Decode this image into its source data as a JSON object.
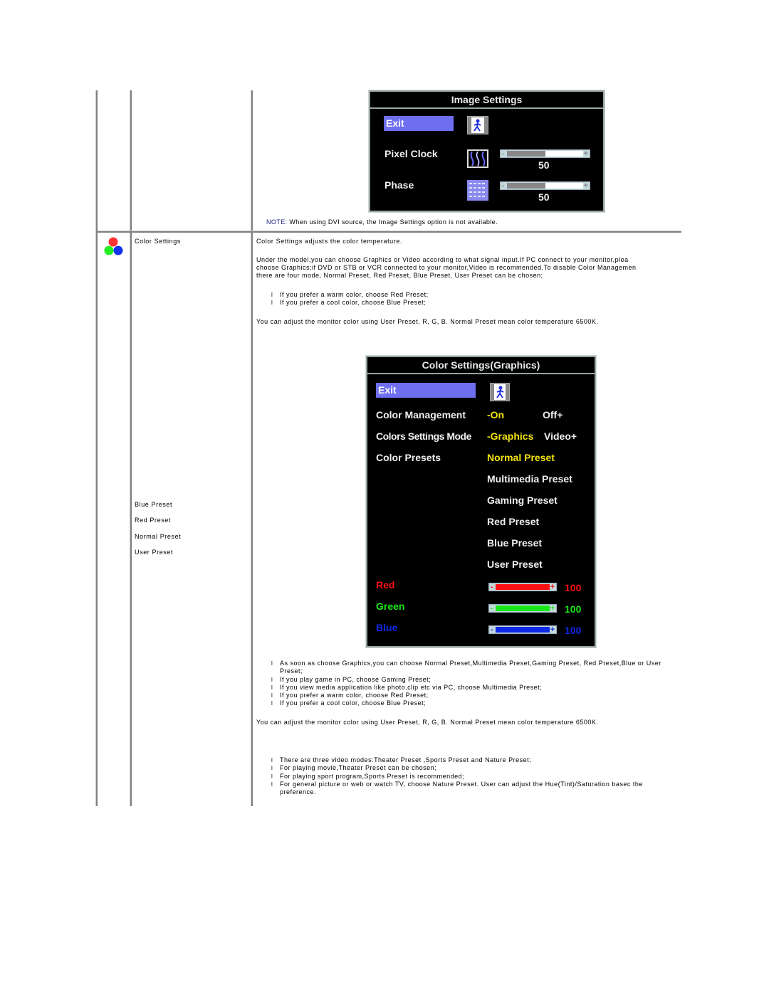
{
  "image_settings_osd": {
    "title": "Image Settings",
    "exit_label": "Exit",
    "rows": [
      {
        "label": "Pixel Clock",
        "icon": "pixel-clock-icon",
        "value": "50",
        "percent": 50
      },
      {
        "label": "Phase",
        "icon": "phase-icon",
        "value": "50",
        "percent": 50
      }
    ],
    "note_label": "NOTE:",
    "note_text": " When using  DVI source, the Image Settings option is not available."
  },
  "color_settings_row": {
    "icon": "color-circles-icon",
    "menu_name": "Color Settings",
    "sub_items": [
      "Blue Preset",
      "Red Preset",
      "Normal Preset",
      "User Preset"
    ],
    "intro": "Color Settings adjusts the color temperature.",
    "paragraph_lines": [
      "Under the model,you can choose Graphics or Video according to what signal input.If PC connect to your monitor,plea",
      "choose Graphics;if DVD or STB or VCR connected to your monitor,Video is recommended.To disable Color Managemen",
      "there are four mode, Normal Preset, Red Preset, Blue Preset, User Preset can be chosen;"
    ],
    "bullets_1": [
      "If you prefer a warm color, choose Red Preset;",
      "If you prefer a cool color, choose Blue Preset;"
    ],
    "adjust_note_1": "You can adjust the monitor color using User Preset, R, G, B. Normal Preset mean color temperature 6500K.",
    "bullets_2": [
      "As soon as choose Graphics,you can choose Normal Preset,Multimedia Preset,Gaming Preset, Red Preset,Blue or User Preset;",
      "If you play game in PC, choose Gaming Preset;",
      "If you view media application like photo,clip etc via PC, choose Multimedia Preset;",
      "If you prefer a warm color, choose Red Preset;",
      "If you prefer a cool color, choose Blue Preset;"
    ],
    "adjust_note_2": "You can adjust the monitor color using User Preset, R, G, B. Normal Preset mean color temperature 6500K.",
    "bullets_3": [
      "There are three video modes:Theater Preset ,Sports Preset and Nature Preset;",
      "For playing movie,Theater Preset can be chosen;",
      "For playing sport program,Sports Preset is recommended;",
      "For general picture or web or watch TV, choose Nature Preset. User can adjust the Hue(Tint)/Saturation basec the preference."
    ],
    "bullet_glyph": "l"
  },
  "color_settings_osd": {
    "title": "Color Settings(Graphics)",
    "exit_label": "Exit",
    "color_management": {
      "label": "Color Management",
      "selected": "-On",
      "other": "Off+"
    },
    "mode": {
      "label": "Colors Settings Mode",
      "selected": "-Graphics",
      "other": "Video+"
    },
    "presets": {
      "label": "Color Presets",
      "selected": "Normal Preset",
      "options": [
        "Multimedia Preset",
        "Gaming Preset",
        "Red Preset",
        "Blue Preset",
        "User Preset"
      ]
    },
    "channels": [
      {
        "label": "Red",
        "value": "100",
        "percent": 100,
        "color": "#ff1010"
      },
      {
        "label": "Green",
        "value": "100",
        "percent": 100,
        "color": "#18e818"
      },
      {
        "label": "Blue",
        "value": "100",
        "percent": 100,
        "color": "#1028e8"
      }
    ],
    "colors": {
      "highlight": "#f2e30c",
      "exit_bg": "#6e6ef0",
      "text": "#eeeeee"
    }
  }
}
